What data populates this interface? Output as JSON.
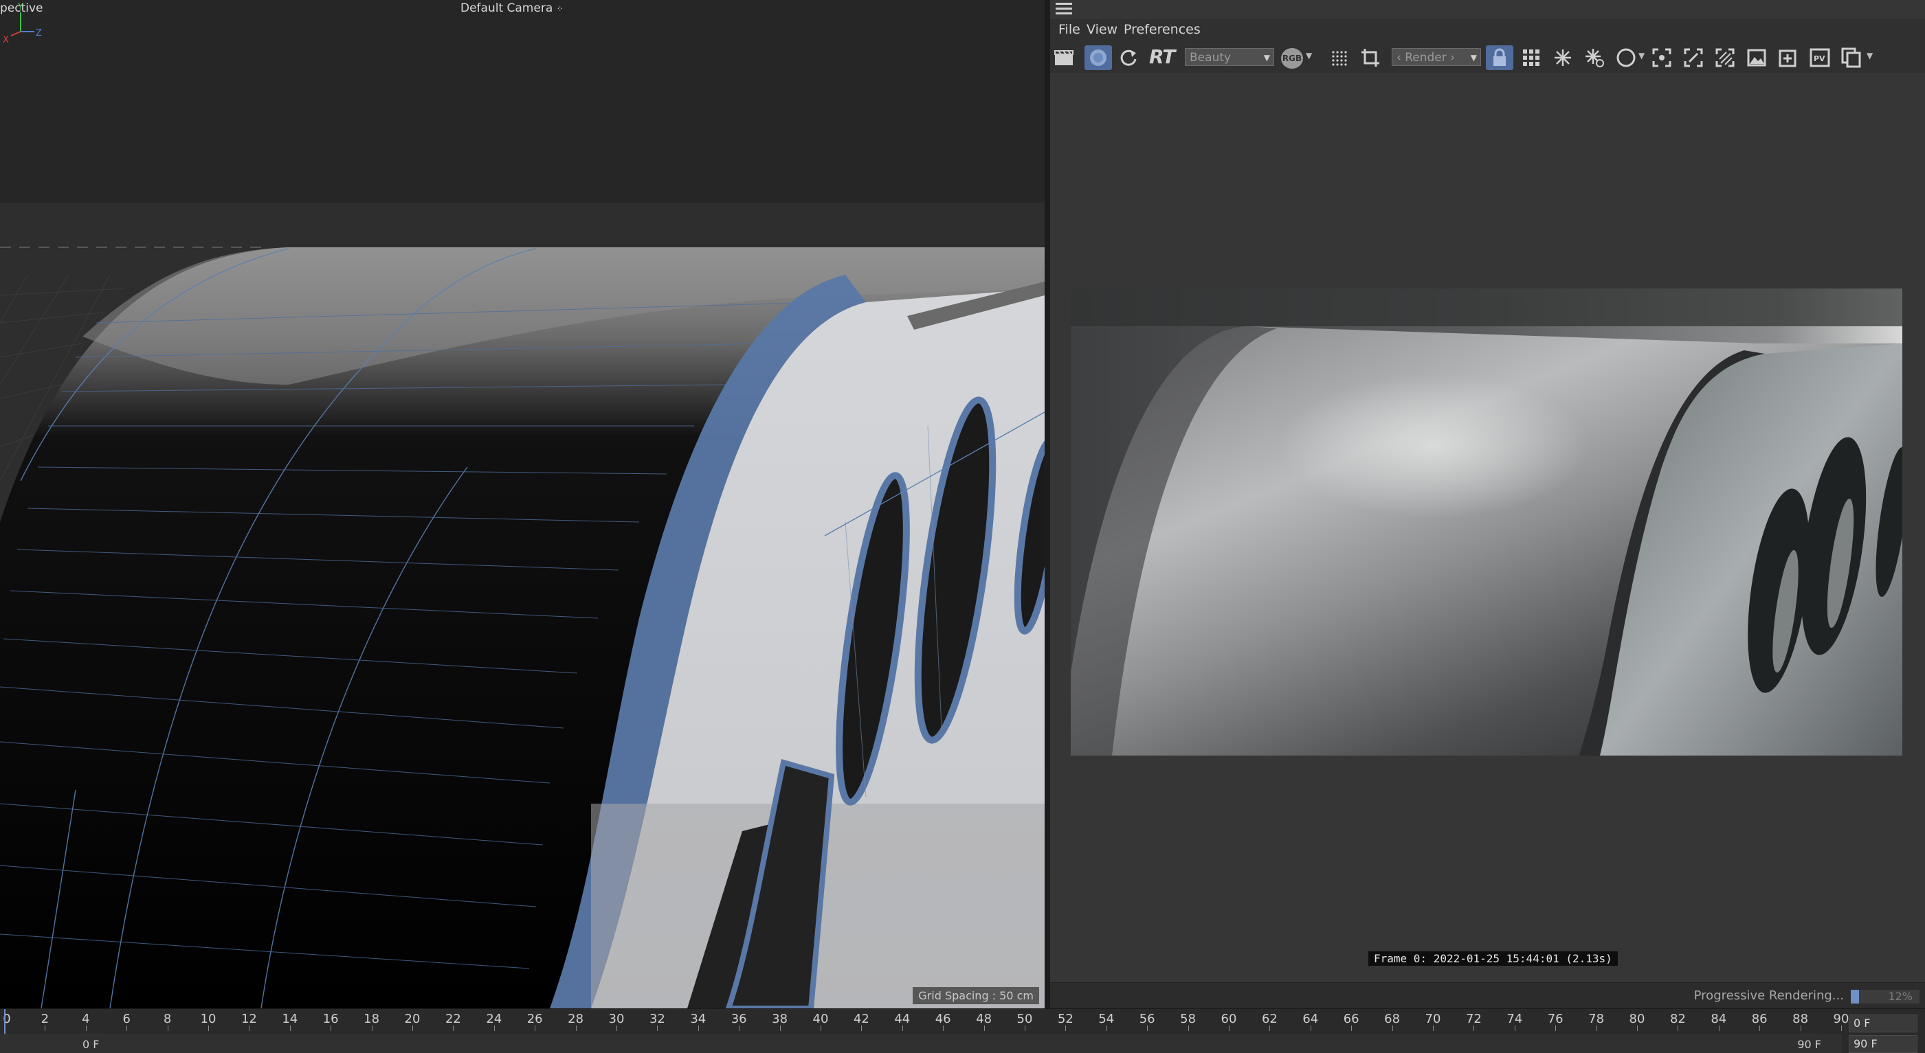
{
  "viewport": {
    "mode_label": "pective",
    "camera_label": "Default Camera",
    "camera_icon": "camera-link-icon",
    "grid_spacing": "Grid Spacing : 50 cm",
    "axis": {
      "x": "X",
      "y": "Y",
      "z": "Z"
    }
  },
  "viewer": {
    "menu": {
      "file": "File",
      "view": "View",
      "preferences": "Preferences"
    },
    "toolbar": {
      "rt_label": "RT",
      "channel_select": "Beauty",
      "rgb_label": "RGB",
      "render_select": "‹ Render ›",
      "pv_label": "PV"
    },
    "frame_info": "Frame 0: 2022-01-25 15:44:01 (2.13s)",
    "status": {
      "text": "Progressive Rendering...",
      "percent_label": "12%",
      "progress": 0.12
    }
  },
  "timeline": {
    "ticks": [
      "0",
      "2",
      "4",
      "6",
      "8",
      "10",
      "12",
      "14",
      "16",
      "18",
      "20",
      "22",
      "24",
      "26",
      "28",
      "30",
      "32",
      "34",
      "36",
      "38",
      "40",
      "42",
      "44",
      "46",
      "48",
      "50",
      "52",
      "54",
      "56",
      "58",
      "60",
      "62",
      "64",
      "66",
      "68",
      "70",
      "72",
      "74",
      "76",
      "78",
      "80",
      "82",
      "84",
      "86",
      "88",
      "90"
    ],
    "range_start": "0 F",
    "range_end": "90 F",
    "current_frame": "0 F",
    "end_frame": "90 F"
  },
  "colors": {
    "accent": "#6d90c6",
    "active_button": "#4f6c9d",
    "background": "#363636"
  }
}
